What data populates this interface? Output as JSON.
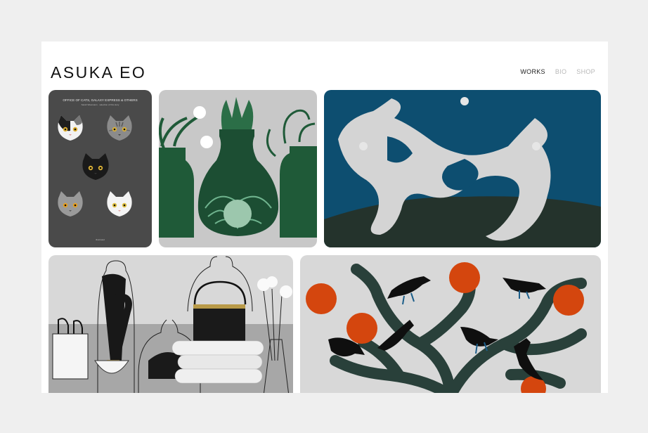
{
  "site": {
    "title": "ASUKA EO"
  },
  "nav": [
    {
      "label": "WORKS",
      "active": true
    },
    {
      "label": "BIO",
      "active": false
    },
    {
      "label": "SHOP",
      "active": false
    }
  ],
  "gallery": {
    "poster": {
      "title": "OFFICE OF CATS, GALAXY EXPRESS & OTHERS",
      "subtitle": "Sarah Wiesmann · selection of this story",
      "footer": "illustrated"
    }
  },
  "colors": {
    "background": "#efefef",
    "card": "#ffffff",
    "nav_active": "#222222",
    "nav_inactive": "#b8b8b8"
  }
}
